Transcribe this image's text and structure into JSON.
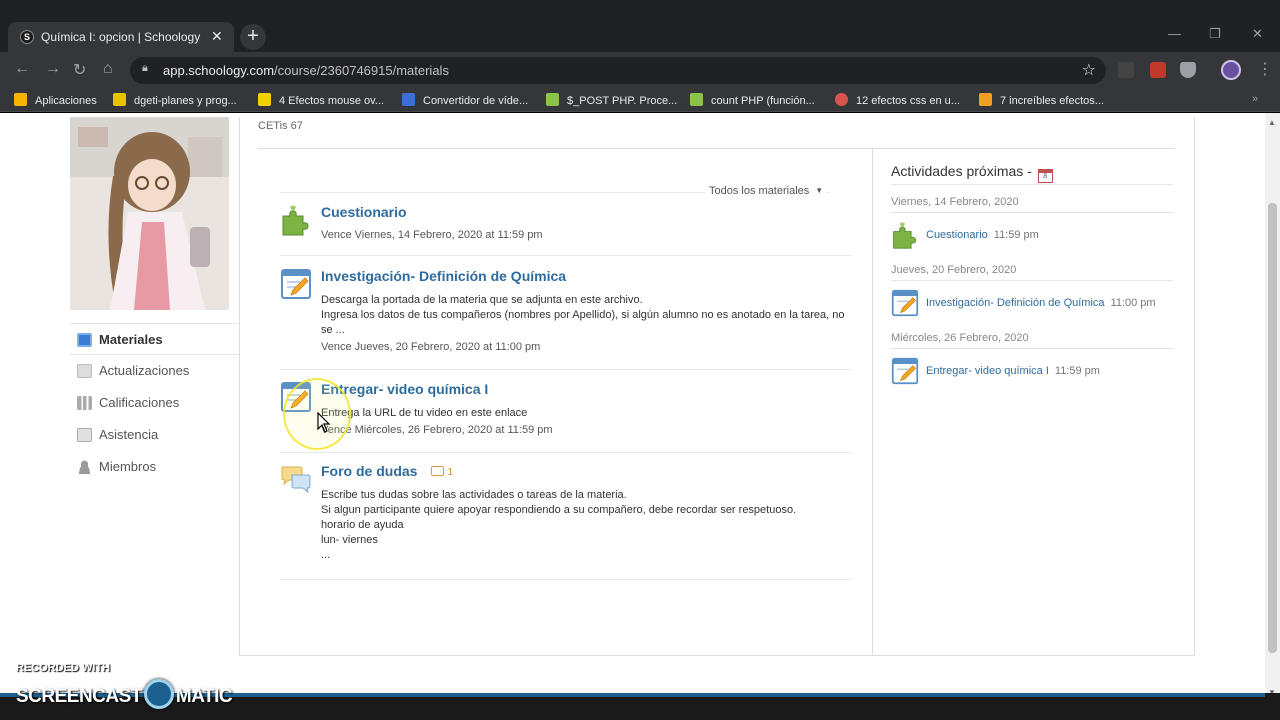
{
  "browser": {
    "tab_title": "Química I: opcion | Schoology",
    "tab_favicon_letter": "S",
    "url_host": "app.schoology.com",
    "url_path": "/course/2360746915/materials",
    "bookmarks": [
      {
        "label": "Aplicaciones",
        "color": "#f4b400"
      },
      {
        "label": "dgeti-planes y prog...",
        "color": "#e8c400"
      },
      {
        "label": "4 Efectos mouse ov...",
        "color": "#f5d000"
      },
      {
        "label": "Convertidor de víde...",
        "color": "#3b6fd6"
      },
      {
        "label": "$_POST PHP. Proce...",
        "color": "#8bc34a"
      },
      {
        "label": "count PHP (función...",
        "color": "#8bc34a"
      },
      {
        "label": "12 efectos css en u...",
        "color": "#d9534f"
      },
      {
        "label": "7 increíbles efectos...",
        "color": "#f0a020"
      }
    ]
  },
  "course": {
    "subtitle": "CETis 67"
  },
  "left_nav": [
    {
      "label": "Materiales",
      "active": true,
      "color": "#3a7bd5"
    },
    {
      "label": "Actualizaciones",
      "active": false,
      "color": "#bbbbbb"
    },
    {
      "label": "Calificaciones",
      "active": false,
      "color": "#aaaaaa"
    },
    {
      "label": "Asistencia",
      "active": false,
      "color": "#aaaaaa"
    },
    {
      "label": "Miembros",
      "active": false,
      "color": "#999999"
    }
  ],
  "materials": {
    "filter_label": "Todos los materiales",
    "items": [
      {
        "type": "quiz",
        "title": "Cuestionario",
        "body": [],
        "due": "Vence Viernes, 14 Febrero, 2020 at 11:59 pm"
      },
      {
        "type": "assignment",
        "title": "Investigación- Definición de Química",
        "body": [
          "Descarga la portada de la materia que se adjunta en este archivo.",
          "Ingresa los datos de tus compañeros (nombres por Apellido), si algún alumno no es anotado en la tarea, no se ..."
        ],
        "due": "Vence Jueves, 20 Febrero, 2020 at 11:00 pm"
      },
      {
        "type": "assignment",
        "title": "Entregar- video química I",
        "body": [
          "Entrega la URL de tu video en este enlace"
        ],
        "due": "Vence Miércoles, 26 Febrero, 2020 at 11:59 pm"
      },
      {
        "type": "discussion",
        "title": "Foro de dudas",
        "comment_count": "1",
        "body": [
          "Escribe tus dudas sobre las actividades o tareas de la materia.",
          "Si algun participante quiere apoyar respondiendo a su compañero, debe recordar ser respetuoso.",
          "horario de ayuda",
          "lun- viernes",
          "..."
        ],
        "due": ""
      }
    ]
  },
  "upcoming": {
    "title": "Actividades próximas -",
    "calendar_day": "8",
    "groups": [
      {
        "date": "Viernes, 14 Febrero, 2020",
        "item": "Cuestionario",
        "time": "11:59 pm",
        "type": "quiz"
      },
      {
        "date": "Jueves, 20 Febrero, 2020",
        "item": "Investigación- Definición de Química",
        "time": "11:00 pm",
        "type": "assignment"
      },
      {
        "date": "Miércoles, 26 Febrero, 2020",
        "item": "Entregar- video química I",
        "time": "11:59 pm",
        "type": "assignment"
      }
    ]
  },
  "watermark": {
    "line1": "RECORDED WITH",
    "brand_left": "SCREENCAST",
    "brand_right": "MATIC"
  },
  "colors": {
    "link": "#2e6c9f",
    "quiz_green": "#7cb342",
    "assignment_blue": "#5b8fc7"
  }
}
